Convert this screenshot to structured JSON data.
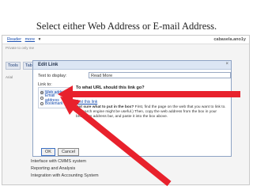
{
  "slide": {
    "title": "Select either Web Address or E-mail Address."
  },
  "app": {
    "header_links": [
      "Reader",
      "more"
    ],
    "header_more_arrow": "▾",
    "user": "cabasela.ano1y",
    "sub_text": "Private to only me",
    "tabs": [
      "Tools",
      "Table"
    ],
    "side_text": "Arial",
    "bottom_items": [
      "Interface with CMMS system",
      "Reporting and Analysis",
      "Integration with Accounting System"
    ]
  },
  "dialog": {
    "title": "Edit Link",
    "close_symbol": "×",
    "text_to_display_label": "Text to display:",
    "text_to_display_value": "Read More",
    "link_to_label": "Link to:",
    "options": [
      {
        "label": "Web address",
        "selected": true
      },
      {
        "label": "Email address",
        "selected": false
      },
      {
        "label": "Bookmark",
        "selected": false
      }
    ],
    "url_question": "To what URL should this link go?",
    "test_link": "Test this link",
    "help_heading": "Not sure what to put in the box?",
    "help_text": "First, find the page on the web that you want to link to. (A search engine might be useful.) Then, copy the web address from the box in your browser's address bar, and paste it into the box above.",
    "ok_label": "OK",
    "cancel_label": "Cancel"
  },
  "colors": {
    "arrow": "#e8212c",
    "link": "#1a4fb0",
    "dialog_bar": "#dce6f4"
  }
}
